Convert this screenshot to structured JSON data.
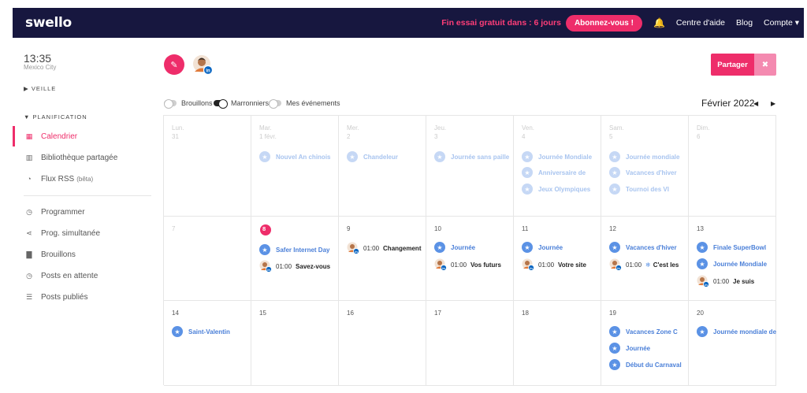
{
  "brand": {
    "logo": "swello"
  },
  "topbar": {
    "trial": "Fin essai gratuit dans : 6 jours",
    "subscribe": "Abonnez-vous !",
    "bell": "🔔",
    "links": {
      "help": "Centre d'aide",
      "blog": "Blog",
      "account": "Compte ▾"
    }
  },
  "sidebar": {
    "time": "13:35",
    "city": "Mexico City",
    "veille": "▶  VEILLE",
    "planification": "▼  PLANIFICATION",
    "items": {
      "calendar": {
        "label": "Calendrier",
        "icon": "▦"
      },
      "library": {
        "label": "Bibliothèque partagée",
        "icon": "▥"
      },
      "rss": {
        "label": "Flux RSS",
        "beta": "(bêta)",
        "icon": "◔"
      },
      "schedule": {
        "label": "Programmer",
        "icon": "◷"
      },
      "simul": {
        "label": "Prog. simultanée",
        "icon": "⋖"
      },
      "drafts": {
        "label": "Brouillons",
        "icon": "▇"
      },
      "pending": {
        "label": "Posts en attente",
        "icon": "◷"
      },
      "published": {
        "label": "Posts publiés",
        "icon": "☰"
      }
    }
  },
  "toolbar": {
    "edit_icon": "✎",
    "share": "Partager",
    "close": "✖",
    "toggles": {
      "drafts": "Brouillons",
      "brands": "Marronniers",
      "events": "Mes événements"
    },
    "month": "Février 2022",
    "prev": "◀",
    "next": "▶"
  },
  "calendar": {
    "week1": {
      "mon": {
        "dayname": "Lun.",
        "num": "31"
      },
      "tue": {
        "dayname": "Mar.",
        "num": "1 févr.",
        "e1": "Nouvel An chinois"
      },
      "wed": {
        "dayname": "Mer.",
        "num": "2",
        "e1": "Chandeleur"
      },
      "thu": {
        "dayname": "Jeu.",
        "num": "3",
        "e1": "Journée sans paille"
      },
      "fri": {
        "dayname": "Ven.",
        "num": "4",
        "e1": "Journée Mondiale",
        "e2": "Anniversaire de",
        "e3": "Jeux Olympiques"
      },
      "sat": {
        "dayname": "Sam.",
        "num": "5",
        "e1": "Journée mondiale",
        "e2": "Vacances d'hiver",
        "e3": "Tournoi des VI"
      },
      "sun": {
        "dayname": "Dim.",
        "num": "6"
      }
    },
    "week2": {
      "mon": {
        "num": "7"
      },
      "tue": {
        "num": "8",
        "e1": "Safer Internet Day",
        "p_time": "01:00",
        "p_text": "Savez-vous"
      },
      "wed": {
        "num": "9",
        "p_time": "01:00",
        "p_text": "Changement"
      },
      "thu": {
        "num": "10",
        "e1": "Journée",
        "p_time": "01:00",
        "p_text": "Vos futurs"
      },
      "fri": {
        "num": "11",
        "e1": "Journée",
        "p_time": "01:00",
        "p_text": "Votre site"
      },
      "sat": {
        "num": "12",
        "e1": "Vacances d'hiver",
        "p_time": "01:00",
        "p_snow": "❄",
        "p_text": "C'est les"
      },
      "sun": {
        "num": "13",
        "e1": "Finale SuperBowl",
        "e2": "Journée Mondiale",
        "p_time": "01:00",
        "p_text": "Je suis"
      }
    },
    "week3": {
      "mon": {
        "num": "14",
        "e1": "Saint-Valentin"
      },
      "tue": {
        "num": "15"
      },
      "wed": {
        "num": "16"
      },
      "thu": {
        "num": "17"
      },
      "fri": {
        "num": "18"
      },
      "sat": {
        "num": "19",
        "e1": "Vacances Zone C",
        "e2": "Journée",
        "e3": "Début du Carnaval"
      },
      "sun": {
        "num": "20",
        "e1": "Journée mondiale de"
      }
    }
  },
  "colors": {
    "accent": "#ee2d6a",
    "navy": "#17173f",
    "event_blue": "#5b92e5",
    "linkedin": "#0a66c2"
  }
}
